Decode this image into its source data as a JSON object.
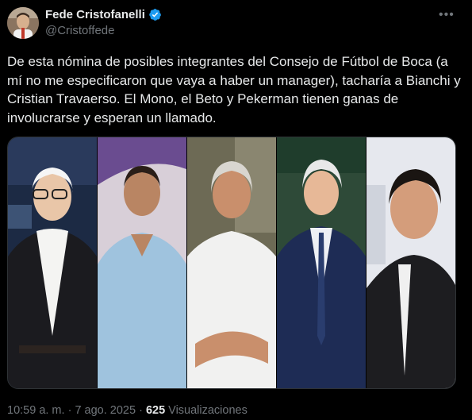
{
  "author": {
    "name": "Fede Cristofanelli",
    "handle": "@Cristoffede",
    "verified_icon": "verified-badge-icon"
  },
  "more_icon": "more-options-icon",
  "tweet_text": "De esta nómina de posibles integrantes del Consejo de Fútbol de Boca (a mí no me especificaron que vaya a haber un manager), tacharía a Bianchi y Cristian Travaerso. El Mono, el Beto y Pekerman tienen ganas de involucrarse y esperan un llamado.",
  "footer": {
    "time": "10:59 a. m.",
    "separator1": " · ",
    "date": "7 ago. 2025",
    "separator2": " · ",
    "views_count": "625",
    "views_label": " Visualizaciones"
  },
  "colors": {
    "background": "#000000",
    "text": "#e7e9ea",
    "secondary": "#71767b",
    "verified": "#1d9bf0"
  }
}
